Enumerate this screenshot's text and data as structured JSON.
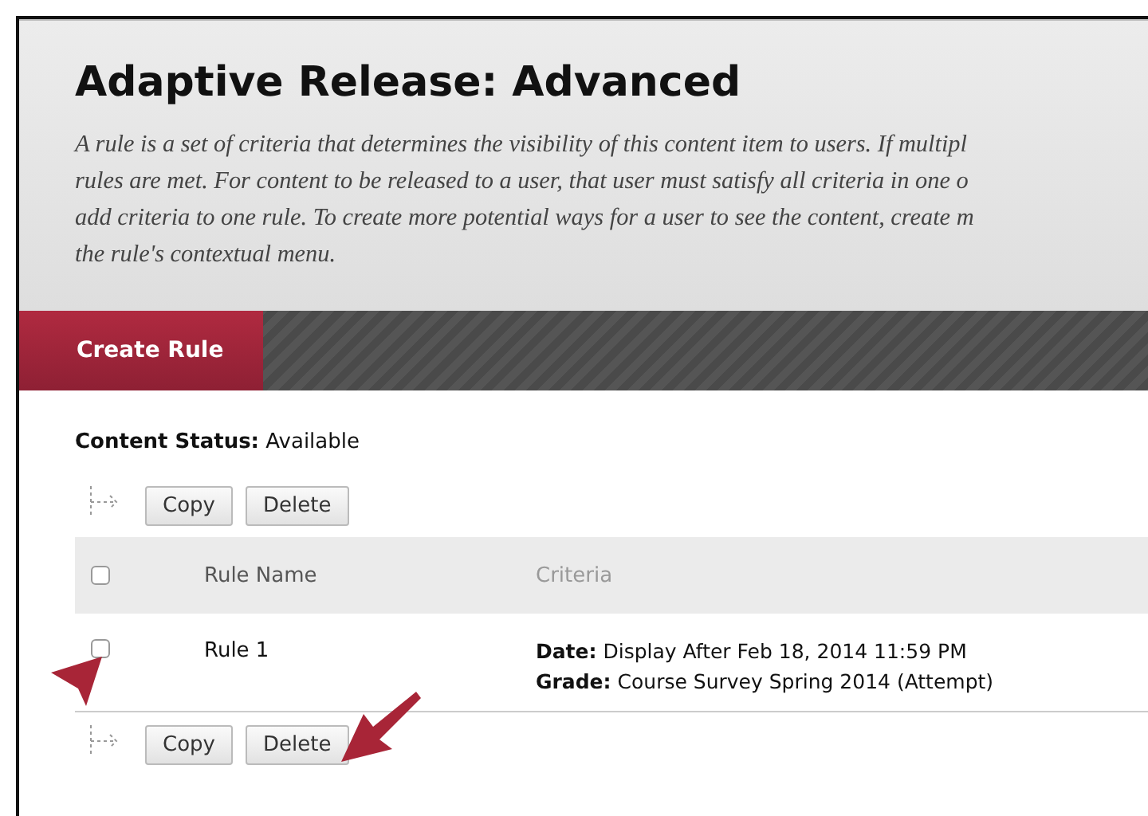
{
  "page": {
    "title": "Adaptive Release: Advanced",
    "description_lines": [
      "A rule is a set of criteria that determines the visibility of this content item to users. If multipl",
      "rules are met. For content to be released to a user, that user must satisfy all criteria in one o",
      "add criteria to one rule. To create more potential ways for a user to see the content, create m",
      "the rule's contextual menu."
    ]
  },
  "action_bar": {
    "buttons": [
      {
        "label": "Create Rule"
      }
    ]
  },
  "content_status": {
    "label": "Content Status:",
    "value": "Available"
  },
  "top_actions": [
    "Copy",
    "Delete"
  ],
  "table": {
    "select_all": {
      "checked": false
    },
    "columns": [
      "Rule Name",
      "Criteria"
    ],
    "rows": [
      {
        "checked": false,
        "name": "Rule 1",
        "criteria": [
          {
            "label": "Date:",
            "value": "Display After Feb 18, 2014 11:59 PM"
          },
          {
            "label": "Grade:",
            "value": "Course Survey Spring 2014 (Attempt)"
          }
        ]
      }
    ]
  },
  "bottom_actions": [
    "Copy",
    "Delete"
  ]
}
